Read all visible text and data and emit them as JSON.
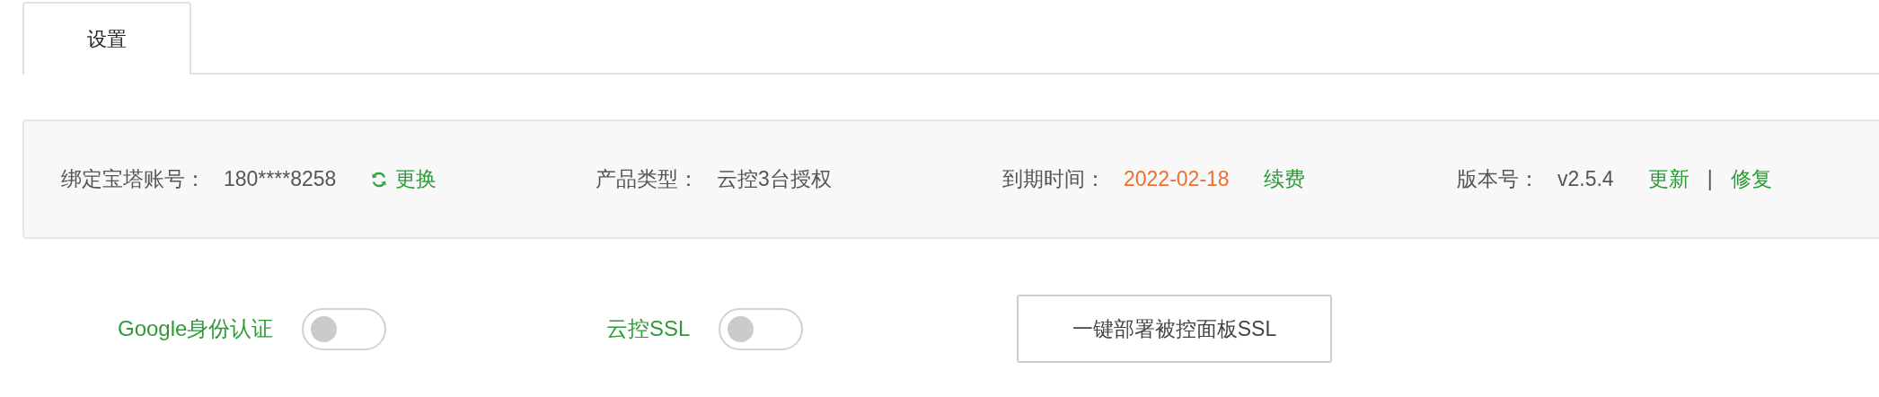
{
  "tabs": [
    {
      "label": "设置",
      "selected": true
    }
  ],
  "info": [
    {
      "label": "绑定宝塔账号：",
      "value": "180****8258",
      "kind": "plain",
      "actions": [
        {
          "kind": "refresh-link",
          "text": "更换"
        }
      ]
    },
    {
      "label": "产品类型：",
      "value": "云控3台授权",
      "kind": "plain"
    },
    {
      "label": "到期时间：",
      "value": "2022-02-18",
      "kind": "date",
      "actions": [
        {
          "kind": "link",
          "text": "续费"
        }
      ]
    },
    {
      "label": "版本号：",
      "value": "v2.5.4",
      "kind": "plain",
      "actions": [
        {
          "kind": "link",
          "text": "更新"
        },
        {
          "kind": "separator",
          "text": "|"
        },
        {
          "kind": "link",
          "text": "修复"
        }
      ]
    }
  ],
  "settings": [
    {
      "kind": "toggle",
      "label": "Google身份认证",
      "on": false
    },
    {
      "kind": "toggle",
      "label": "云控SSL",
      "on": false
    },
    {
      "kind": "button",
      "label": "一键部署被控面板SSL"
    }
  ]
}
